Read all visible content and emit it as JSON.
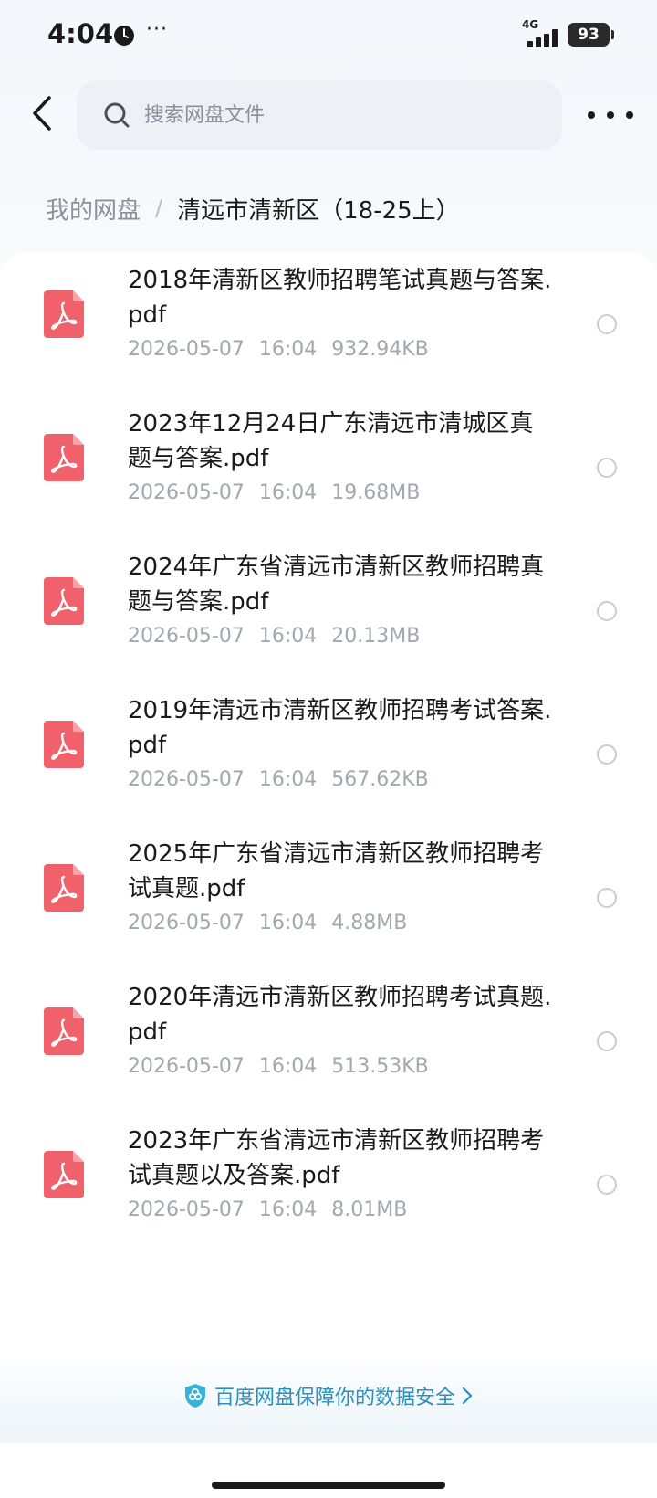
{
  "status_bar": {
    "time": "4:04",
    "more": "···",
    "network": "4G",
    "battery": "93"
  },
  "search": {
    "placeholder": "搜索网盘文件"
  },
  "breadcrumb": {
    "root": "我的网盘",
    "separator": "/",
    "current": "清远市清新区（18-25上）"
  },
  "files": [
    {
      "name": "2018年清新区教师招聘笔试真题与答案.pdf",
      "date": "2026-05-07",
      "time": "16:04",
      "size": "932.94KB"
    },
    {
      "name": "2023年12月24日广东清远市清城区真题与答案.pdf",
      "date": "2026-05-07",
      "time": "16:04",
      "size": "19.68MB"
    },
    {
      "name": "2024年广东省清远市清新区教师招聘真题与答案.pdf",
      "date": "2026-05-07",
      "time": "16:04",
      "size": "20.13MB"
    },
    {
      "name": "2019年清远市清新区教师招聘考试答案.pdf",
      "date": "2026-05-07",
      "time": "16:04",
      "size": "567.62KB"
    },
    {
      "name": "2025年广东省清远市清新区教师招聘考试真题.pdf",
      "date": "2026-05-07",
      "time": "16:04",
      "size": "4.88MB"
    },
    {
      "name": "2020年清远市清新区教师招聘考试真题.pdf",
      "date": "2026-05-07",
      "time": "16:04",
      "size": "513.53KB"
    },
    {
      "name": "2023年广东省清远市清新区教师招聘考试真题以及答案.pdf",
      "date": "2026-05-07",
      "time": "16:04",
      "size": "8.01MB"
    }
  ],
  "footer": {
    "security_text": "百度网盘保障你的数据安全"
  },
  "colors": {
    "pdf_icon": "#f0616b",
    "link": "#2a8fbf"
  }
}
